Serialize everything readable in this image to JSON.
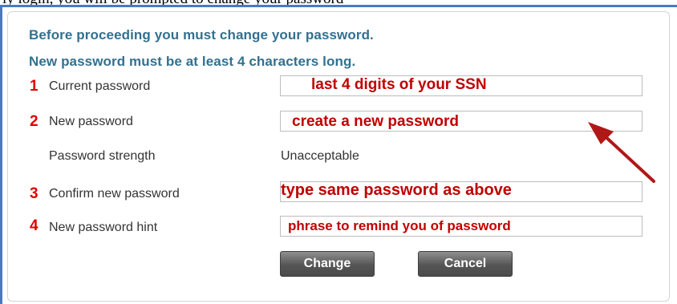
{
  "top_text": "ly login, you will be prompted to change your password",
  "instructions": {
    "line1": "Before proceeding you must change your password.",
    "line2": "New password must be at least 4 characters long."
  },
  "fields": {
    "current": {
      "number": "1",
      "label": "Current password",
      "annotation": "last 4 digits of your SSN"
    },
    "new": {
      "number": "2",
      "label": "New password",
      "annotation": "create a new password"
    },
    "strength": {
      "label": "Password strength",
      "value": "Unacceptable"
    },
    "confirm": {
      "number": "3",
      "label": "Confirm new password",
      "annotation": "type same password as above"
    },
    "hint": {
      "number": "4",
      "label": "New password hint",
      "annotation": "phrase to remind you of password"
    }
  },
  "buttons": {
    "change": "Change",
    "cancel": "Cancel"
  },
  "colors": {
    "annotation": "#c00000",
    "step_number": "#e00000",
    "instruction": "#33708f",
    "frame": "#4a79c2"
  }
}
